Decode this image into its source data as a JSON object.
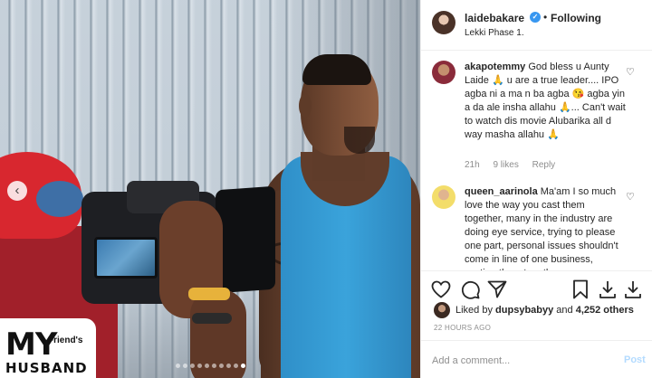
{
  "post_media": {
    "logo": {
      "line1": "MY",
      "line2": "Friend's",
      "line3": "HUSBAND"
    },
    "carousel": {
      "total_slides": 10,
      "active_index": 9
    }
  },
  "header": {
    "username": "laidebakare",
    "verified": true,
    "separator": "•",
    "follow_label": "Following",
    "location": "Lekki Phase 1."
  },
  "comments": [
    {
      "username": "akapotemmy",
      "text": "God bless u Aunty Laide 🙏 u are a true leader.... IPO agba ni a ma n ba agba 😘 agba yin a da ale insha allahu 🙏... Can't wait to watch dis movie Alubarika all d way masha allahu 🙏",
      "time": "21h",
      "likes": "9 likes",
      "reply_label": "Reply"
    },
    {
      "username": "queen_aarinola",
      "text": "Ma'am I so much love the way you cast them together, many in the industry are doing eye service, trying to please one part, personal issues shouldn't come in line of one business, casting them together",
      "time": "",
      "likes": "",
      "reply_label": ""
    }
  ],
  "likes": {
    "prefix": "Liked by",
    "user": "dupsybabyy",
    "connector": "and",
    "others": "4,252 others"
  },
  "timestamp": "22 HOURS AGO",
  "add_comment": {
    "placeholder": "Add a comment...",
    "post_label": "Post"
  },
  "colors": {
    "accent_blue": "#3897f0",
    "post_disabled": "#b3dbff",
    "secondary_text": "#8e8e8e",
    "primary_text": "#262626"
  },
  "icons": {
    "heart": "heart-icon",
    "comment": "comment-icon",
    "share": "share-icon",
    "save": "bookmark-icon",
    "download": "download-icon",
    "verified": "verified-badge-icon",
    "prev": "chevron-left-icon"
  }
}
